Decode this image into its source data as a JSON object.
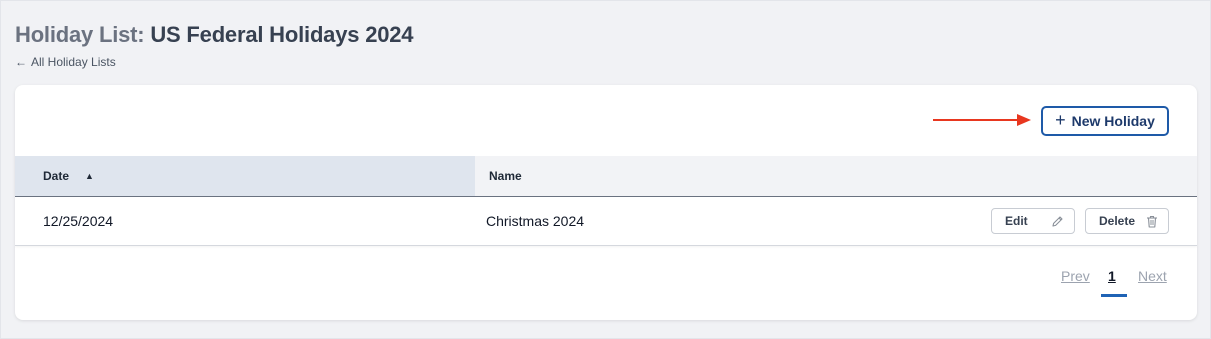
{
  "header": {
    "title_prefix": "Holiday List:",
    "title_name": "US Federal Holidays 2024",
    "back_link": "All Holiday Lists",
    "back_icon": "←"
  },
  "toolbar": {
    "new_button_label": "New Holiday",
    "new_button_icon": "+"
  },
  "table": {
    "columns": [
      {
        "label": "Date",
        "sort_icon": "▲"
      },
      {
        "label": "Name"
      }
    ],
    "rows": [
      {
        "date": "12/25/2024",
        "name": "Christmas 2024",
        "edit_label": "Edit",
        "delete_label": "Delete"
      }
    ]
  },
  "pagination": {
    "prev_label": "Prev",
    "current_page": "1",
    "next_label": "Next"
  },
  "colors": {
    "accent": "#1e5aa8",
    "annotation_arrow": "#e8371f",
    "page_background": "#f1f2f5"
  },
  "icons": {
    "back": "arrow-left-icon",
    "new": "plus-icon",
    "sort": "sort-ascending-icon",
    "edit": "pencil-icon",
    "delete": "trash-icon"
  }
}
